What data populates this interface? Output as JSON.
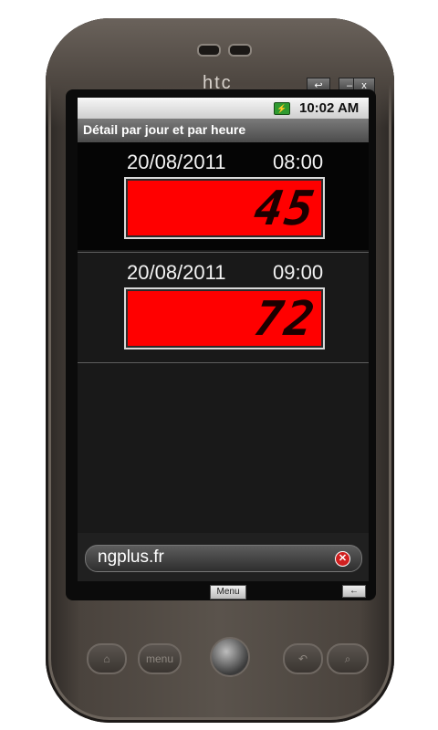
{
  "device": {
    "brand": "htc",
    "window_buttons": [
      "↩",
      "–",
      "x"
    ]
  },
  "status_bar": {
    "battery_icon": "battery-icon",
    "time": "10:02 AM"
  },
  "app": {
    "title": "Détail par jour et par heure"
  },
  "entries": [
    {
      "date": "20/08/2011",
      "time": "08:00",
      "value": "45"
    },
    {
      "date": "20/08/2011",
      "time": "09:00",
      "value": "72"
    }
  ],
  "ad": {
    "text": "ngplus.fr",
    "close_icon": "close-icon"
  },
  "emulator": {
    "menu_label": "Menu",
    "back_label": "←"
  },
  "hardware_buttons": {
    "menu_label": "menu"
  },
  "colors": {
    "lcd_background": "#ff0000",
    "title_bar": "#5e5e5e"
  }
}
